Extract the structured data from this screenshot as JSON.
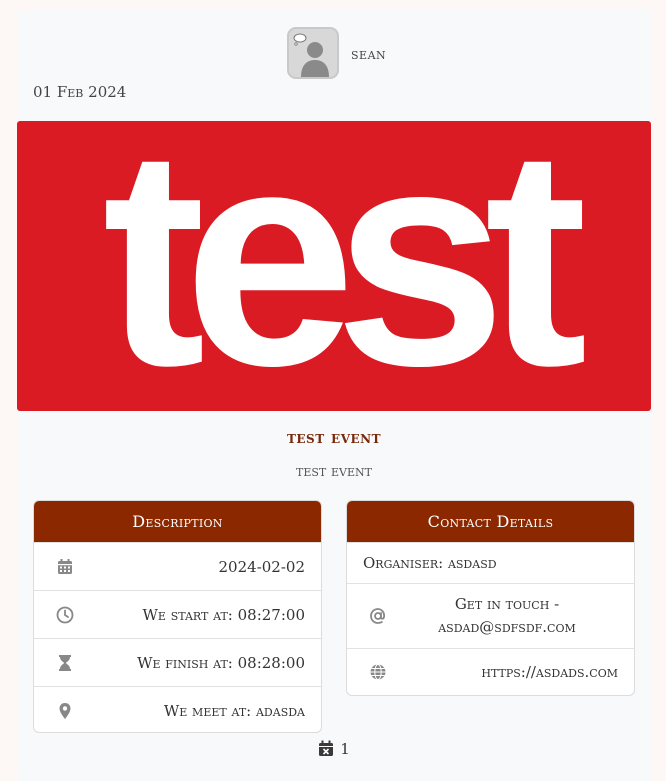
{
  "author": {
    "name": "sean"
  },
  "post": {
    "date": "01 Feb 2024"
  },
  "banner": {
    "text": "test",
    "background": "#db1b24"
  },
  "event": {
    "title": "test event",
    "subtitle": "test event"
  },
  "description_card": {
    "header": "Description",
    "date": "2024-02-02",
    "start": "We start at: 08:27:00",
    "finish": "We finish at: 08:28:00",
    "meet": "We meet at: adasda"
  },
  "contact_card": {
    "header": "Contact Details",
    "organiser": "Organiser: asdasd",
    "email": "Get in touch - asdad@sdfsdf.com",
    "website": "https://asdads.com"
  },
  "attendance": {
    "count": "1"
  },
  "colors": {
    "accent": "#8b2800",
    "title": "#7a2a0c"
  }
}
